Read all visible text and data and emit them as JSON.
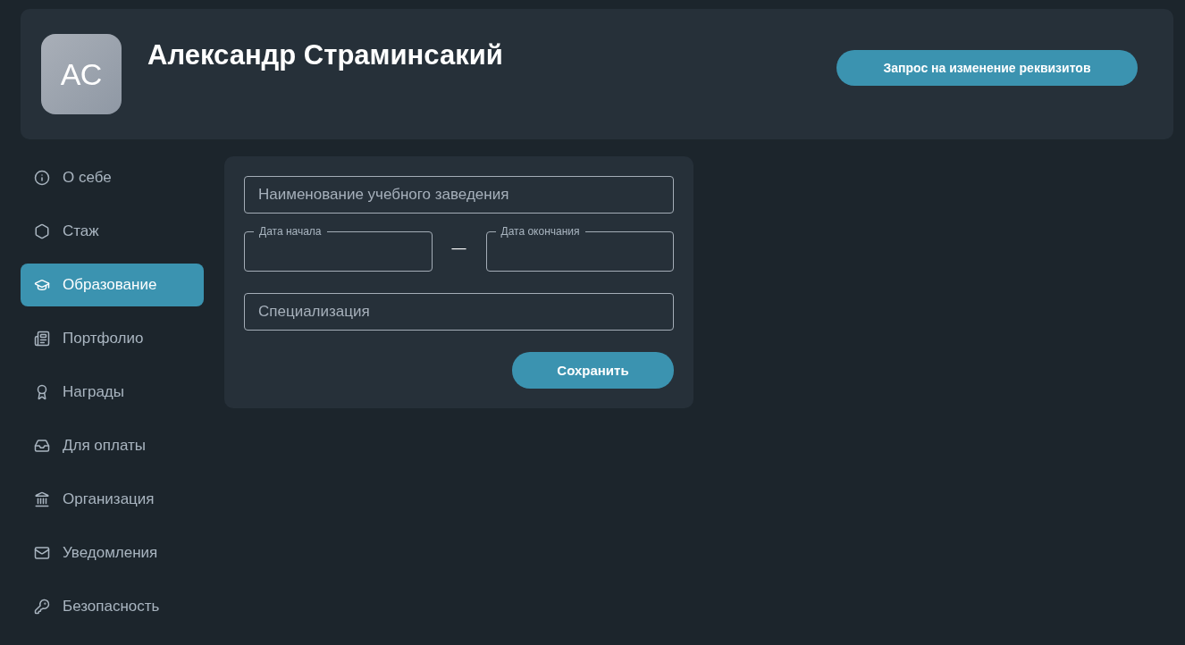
{
  "profile": {
    "initials": "АС",
    "name": "Александр Страминсакий",
    "request_button": "Запрос на изменение реквизитов"
  },
  "sidebar": {
    "items": [
      {
        "label": "О себе",
        "selected": false
      },
      {
        "label": "Стаж",
        "selected": false
      },
      {
        "label": "Образование",
        "selected": true
      },
      {
        "label": "Портфолио",
        "selected": false
      },
      {
        "label": "Награды",
        "selected": false
      },
      {
        "label": "Для оплаты",
        "selected": false
      },
      {
        "label": "Организация",
        "selected": false
      },
      {
        "label": "Уведомления",
        "selected": false
      },
      {
        "label": "Безопасность",
        "selected": false
      }
    ]
  },
  "form": {
    "institution": {
      "placeholder": "Наименование учебного заведения"
    },
    "start_date": {
      "label": "Дата начала"
    },
    "separator": "—",
    "end_date": {
      "label": "Дата окончания"
    },
    "specialization": {
      "placeholder": "Специализация"
    },
    "save_button": "Сохранить"
  }
}
